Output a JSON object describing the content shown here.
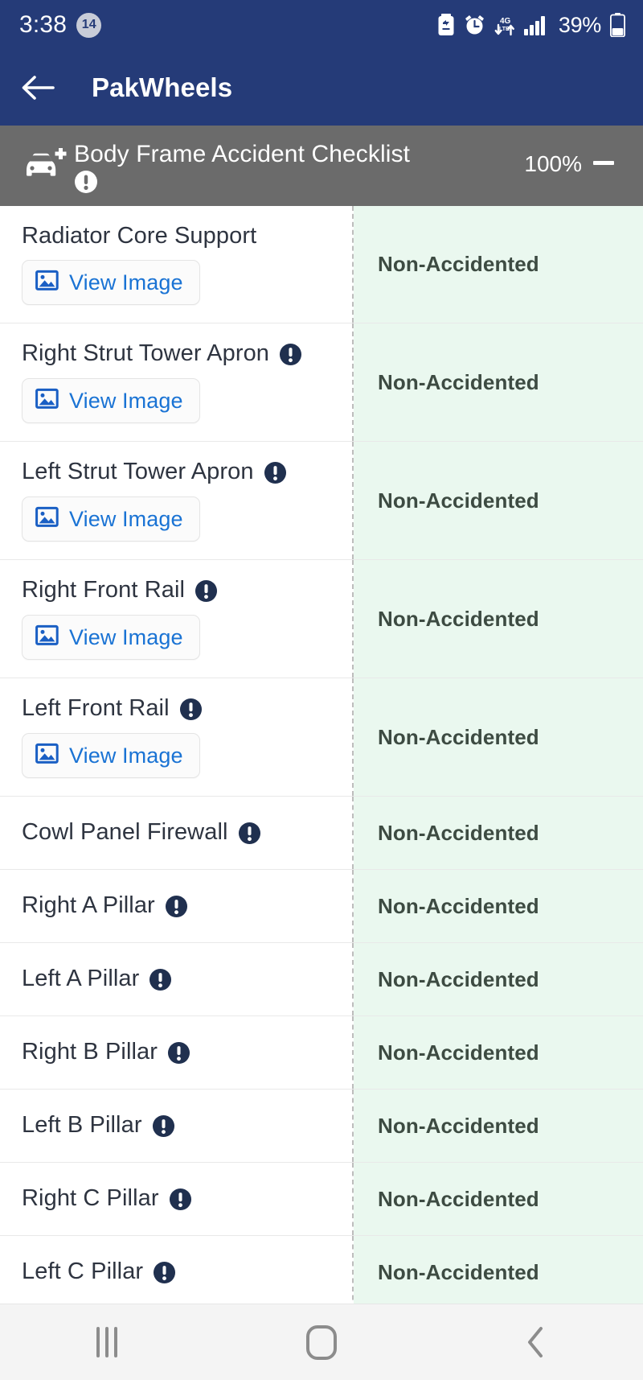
{
  "status_bar": {
    "time": "3:38",
    "notification_count": "14",
    "battery_percent": "39%",
    "icons": [
      "battery-saver-icon",
      "alarm-clock-icon",
      "mobile-data-4g-icon",
      "signal-bars-icon",
      "battery-icon"
    ],
    "background_color": "#253b78"
  },
  "app_bar": {
    "back_label": "back-arrow",
    "title": "PakWheels"
  },
  "section_header": {
    "car_icon": "car-plus-icon",
    "title": "Body Frame Accident Checklist",
    "info_icon": "info-exclamation-icon",
    "percent": "100%",
    "collapse_label": "collapse",
    "background_color": "#6b6b6b"
  },
  "checklist": {
    "view_image_label": "View Image",
    "status_background_color": "#eaf8ef",
    "rows": [
      {
        "part": "Radiator Core Support",
        "has_info": false,
        "has_image": true,
        "status": "Non-Accidented"
      },
      {
        "part": "Right Strut Tower Apron",
        "has_info": true,
        "has_image": true,
        "status": "Non-Accidented"
      },
      {
        "part": "Left Strut Tower Apron",
        "has_info": true,
        "has_image": true,
        "status": "Non-Accidented"
      },
      {
        "part": "Right Front Rail",
        "has_info": true,
        "has_image": true,
        "status": "Non-Accidented"
      },
      {
        "part": "Left Front Rail",
        "has_info": true,
        "has_image": true,
        "status": "Non-Accidented"
      },
      {
        "part": "Cowl Panel Firewall",
        "has_info": true,
        "has_image": false,
        "status": "Non-Accidented"
      },
      {
        "part": "Right A Pillar",
        "has_info": true,
        "has_image": false,
        "status": "Non-Accidented"
      },
      {
        "part": "Left A Pillar",
        "has_info": true,
        "has_image": false,
        "status": "Non-Accidented"
      },
      {
        "part": "Right B Pillar",
        "has_info": true,
        "has_image": false,
        "status": "Non-Accidented"
      },
      {
        "part": "Left B Pillar",
        "has_info": true,
        "has_image": false,
        "status": "Non-Accidented"
      },
      {
        "part": "Right C Pillar",
        "has_info": true,
        "has_image": false,
        "status": "Non-Accidented"
      },
      {
        "part": "Left C Pillar",
        "has_info": true,
        "has_image": false,
        "status": "Non-Accidented"
      }
    ]
  },
  "nav_bar": {
    "recents_label": "recents-icon",
    "home_label": "home-icon",
    "back_label": "back-icon"
  }
}
